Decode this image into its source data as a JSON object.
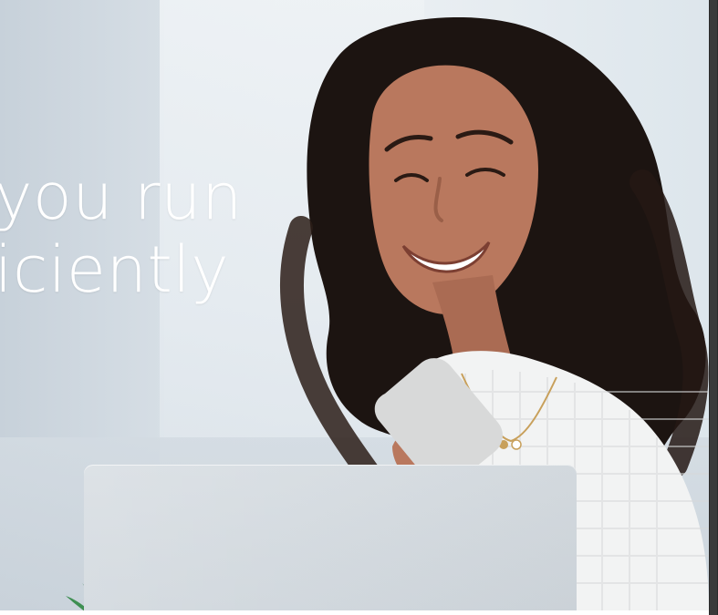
{
  "hero": {
    "headline_lines": [
      "you run",
      "iciently"
    ]
  },
  "icons": {
    "scrollbar": "scrollbar-thumb",
    "plant": "plant-icon"
  },
  "colors": {
    "headline_text": "#ffffff",
    "scrollbar_track": "#2b2b2b"
  }
}
